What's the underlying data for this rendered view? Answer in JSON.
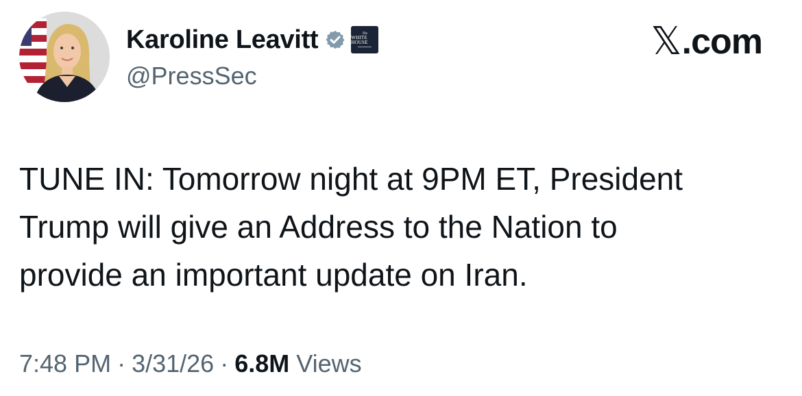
{
  "author": {
    "display_name": "Karoline Leavitt",
    "handle": "@PressSec",
    "verified_icon": "verified-badge-icon",
    "affiliate_badge_icon": "white-house-badge-icon",
    "affiliate_label_top": "The",
    "affiliate_label_bottom": "WHITE HOUSE"
  },
  "site": {
    "x_glyph": "𝕏",
    "label": ".com"
  },
  "tweet": {
    "text": "TUNE IN: Tomorrow night at 9PM ET, President\nTrump will give an Address to the Nation to\nprovide an important update on Iran."
  },
  "meta": {
    "time": "7:48 PM",
    "date": "3/31/26",
    "separator": "·",
    "views_count": "6.8M",
    "views_label": "Views"
  },
  "colors": {
    "text_primary": "#0f1419",
    "text_secondary": "#536471",
    "verified_blue": "#829aab",
    "badge_navy": "#1b2436"
  }
}
